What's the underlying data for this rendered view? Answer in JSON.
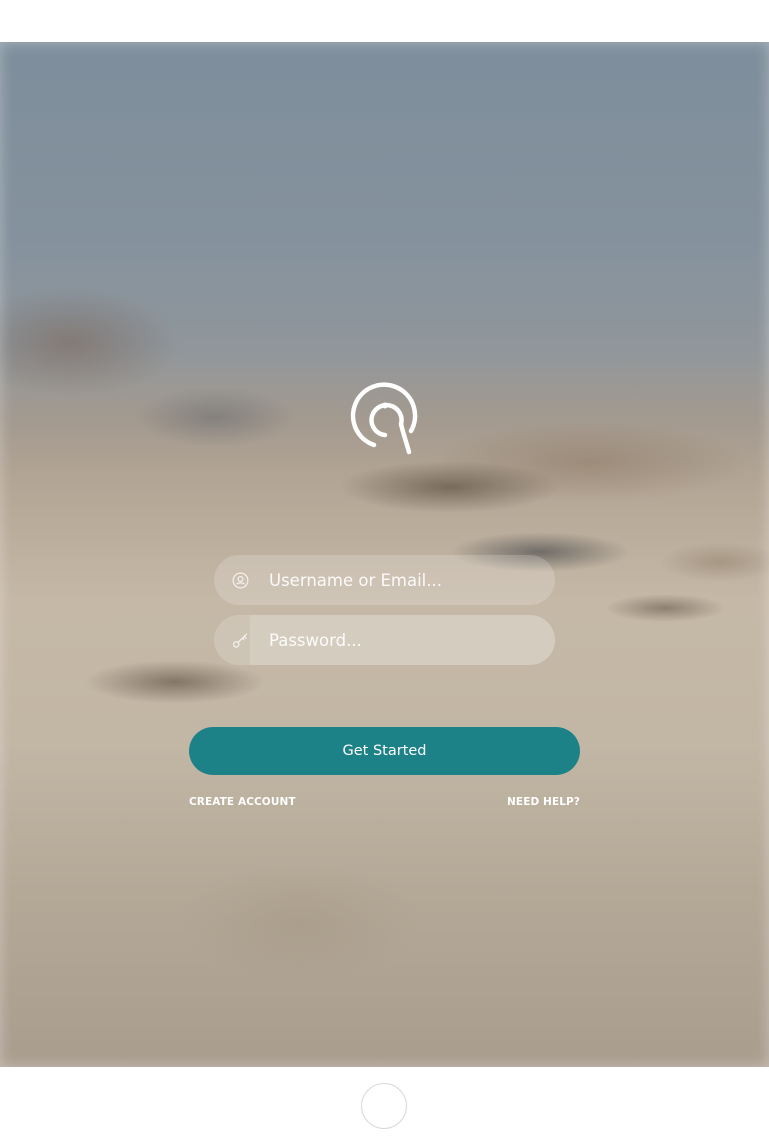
{
  "login": {
    "username": {
      "placeholder": "Username or Email...",
      "value": "",
      "icon": "user-circle-icon"
    },
    "password": {
      "placeholder": "Password...",
      "value": "",
      "icon": "key-icon"
    },
    "submit_label": "Get Started",
    "create_account_label": "CREATE ACCOUNT",
    "need_help_label": "NEED HELP?"
  },
  "branding": {
    "logo_icon": "bird-logo-icon"
  },
  "device": {
    "home_button_icon": "home-button"
  },
  "colors": {
    "accent": "#1c8288",
    "text": "#ffffff"
  }
}
